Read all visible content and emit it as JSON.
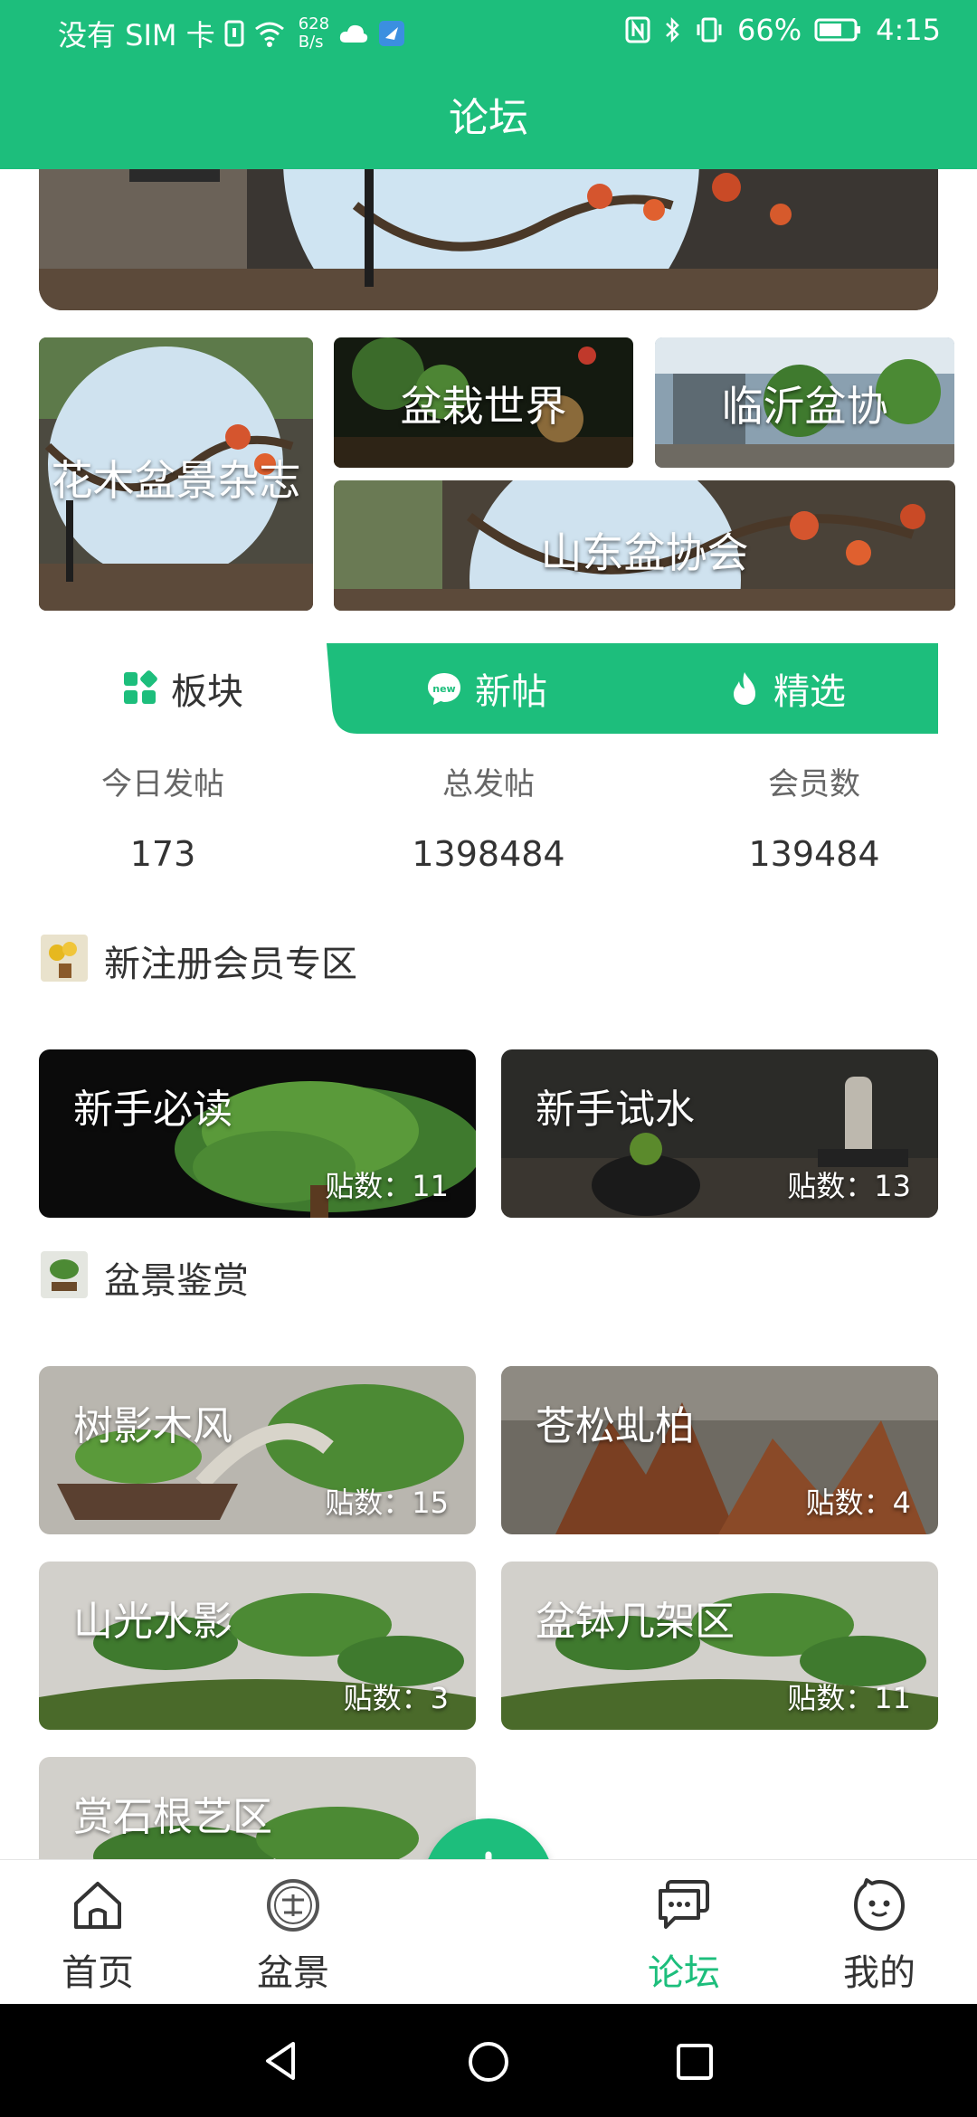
{
  "status": {
    "carrier": "没有 SIM 卡",
    "speed_value": "628",
    "speed_unit": "B/s",
    "battery": "66%",
    "time": "4:15"
  },
  "header": {
    "title": "论坛"
  },
  "banners": {
    "magazine": "花木盆景杂志",
    "world": "盆栽世界",
    "linyi": "临沂盆协",
    "shandong": "山东盆协会"
  },
  "tabs": [
    {
      "label": "板块",
      "icon": "grid-icon"
    },
    {
      "label": "新帖",
      "icon": "new-icon"
    },
    {
      "label": "精选",
      "icon": "fire-icon"
    }
  ],
  "stats": [
    {
      "label": "今日发帖",
      "value": "173"
    },
    {
      "label": "总发帖",
      "value": "1398484"
    },
    {
      "label": "会员数",
      "value": "139484"
    }
  ],
  "sections": [
    {
      "title": "新注册会员专区",
      "boards": [
        {
          "title": "新手必读",
          "count": "贴数：11"
        },
        {
          "title": "新手试水",
          "count": "贴数：13"
        }
      ]
    },
    {
      "title": "盆景鉴赏",
      "boards": [
        {
          "title": "树影木风",
          "count": "贴数：15"
        },
        {
          "title": "苍松虬柏",
          "count": "贴数：4"
        },
        {
          "title": "山光水影",
          "count": "贴数：3"
        },
        {
          "title": "盆钵几架区",
          "count": "贴数：11"
        },
        {
          "title": "赏石根艺区",
          "count": ""
        }
      ]
    }
  ],
  "bottom_nav": [
    {
      "label": "首页",
      "icon": "home-icon"
    },
    {
      "label": "盆景",
      "icon": "bonsai-icon"
    },
    {
      "label": "论坛",
      "icon": "forum-icon",
      "active": true
    },
    {
      "label": "我的",
      "icon": "profile-icon"
    }
  ],
  "colors": {
    "accent": "#1dbe7c",
    "text": "#333333",
    "muted": "#666666"
  }
}
